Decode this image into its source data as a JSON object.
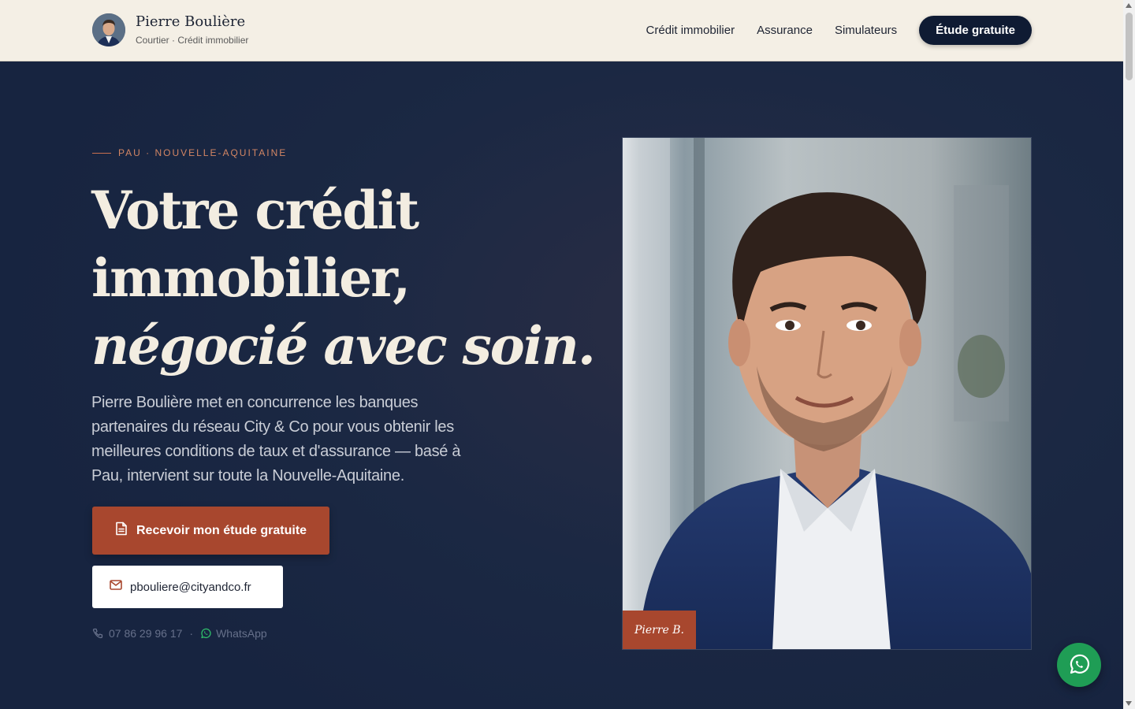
{
  "header": {
    "brand_name": "Pierre Boulière",
    "brand_subtitle": "Courtier · Crédit immobilier",
    "nav": [
      {
        "label": "Crédit immobilier"
      },
      {
        "label": "Assurance"
      },
      {
        "label": "Simulateurs"
      }
    ],
    "cta_label": "Étude gratuite"
  },
  "hero": {
    "eyebrow": "PAU · NOUVELLE-AQUITAINE",
    "headline_line1": "Votre crédit",
    "headline_line2": "immobilier,",
    "headline_line3": "négocié avec soin.",
    "lead": "Pierre Boulière met en concurrence les banques partenaires du réseau City & Co pour vous obtenir les meilleures conditions de taux et d'assurance — basé à Pau, intervient sur toute la Nouvelle-Aquitaine.",
    "primary_cta": "Recevoir mon étude gratuite",
    "email": "pbouliere@cityandco.fr",
    "phone": "07 86 29 96 17",
    "separator": "·",
    "whatsapp_label": "WhatsApp",
    "photo_caption": "Pierre B."
  },
  "icons": {
    "document": "document-icon",
    "mail": "mail-icon",
    "phone": "phone-icon",
    "whatsapp": "whatsapp-icon"
  },
  "colors": {
    "header_bg": "#f4efe5",
    "hero_bg": "#1b2843",
    "accent": "#a8472e",
    "navy": "#0f1b33",
    "whatsapp": "#1f9d55"
  }
}
